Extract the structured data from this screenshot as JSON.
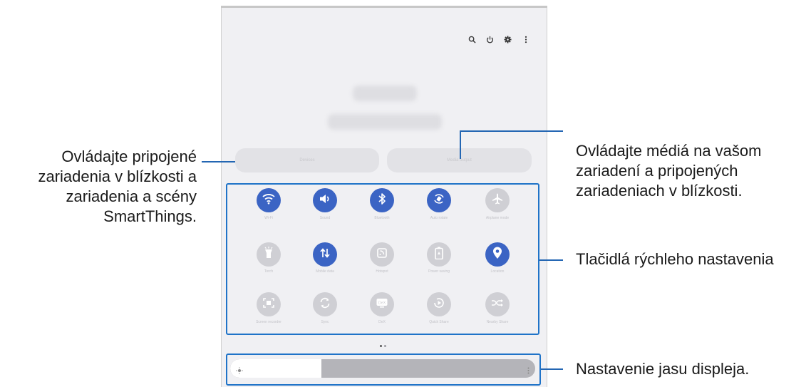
{
  "annotations": {
    "connected_devices": [
      "Ovládajte pripojené",
      "zariadenia v blízkosti a",
      "zariadenia a scény",
      "SmartThings."
    ],
    "media": [
      "Ovládajte médiá na vašom",
      "zariadení a pripojených",
      "zariadeniach v blízkosti."
    ],
    "quick_settings": "Tlačidlá rýchleho nastavenia",
    "brightness": "Nastavenie jasu displeja."
  },
  "panel": {
    "top_icons": [
      "search-icon",
      "power-icon",
      "gear-icon",
      "more-vertical-icon"
    ],
    "cards": {
      "devices_label": "Devices",
      "media_label": "Media output"
    }
  },
  "quick_settings": {
    "tiles": [
      {
        "name": "wifi",
        "icon": "wifi-icon",
        "label": "Wi-Fi",
        "on": true
      },
      {
        "name": "sound",
        "icon": "speaker-icon",
        "label": "Sound",
        "on": true
      },
      {
        "name": "bluetooth",
        "icon": "bluetooth-icon",
        "label": "Bluetooth",
        "on": true
      },
      {
        "name": "auto-rotate",
        "icon": "rotate-icon",
        "label": "Auto rotate",
        "on": true
      },
      {
        "name": "airplane",
        "icon": "airplane-icon",
        "label": "Airplane mode",
        "on": false
      },
      {
        "name": "flashlight",
        "icon": "flashlight-icon",
        "label": "Torch",
        "on": false
      },
      {
        "name": "mobile-data",
        "icon": "data-arrows-icon",
        "label": "Mobile data",
        "on": true
      },
      {
        "name": "nfc",
        "icon": "nfc-icon",
        "label": "Hotspot",
        "on": false
      },
      {
        "name": "power-saving",
        "icon": "battery-icon",
        "label": "Power saving",
        "on": false
      },
      {
        "name": "location",
        "icon": "location-pin-icon",
        "label": "Location",
        "on": true
      },
      {
        "name": "screen-recorder",
        "icon": "screen-record-icon",
        "label": "Screen recorder",
        "on": false
      },
      {
        "name": "smart-view",
        "icon": "sync-icon",
        "label": "Sync",
        "on": false
      },
      {
        "name": "dex",
        "icon": "dex-icon",
        "label": "DeX",
        "on": false
      },
      {
        "name": "quick-share",
        "icon": "share-icon",
        "label": "Quick Share",
        "on": false
      },
      {
        "name": "nearby-share",
        "icon": "shuffle-icon",
        "label": "Nearby Share",
        "on": false
      }
    ],
    "page_indicator": "1 of 2"
  },
  "brightness": {
    "level_fraction": 0.3,
    "sun_icon": "sun-icon",
    "more_icon": "more-vertical-icon"
  },
  "colors": {
    "tile_on": "#3b64c4",
    "tile_off": "#cfcfd4",
    "callout": "#2366b3"
  }
}
